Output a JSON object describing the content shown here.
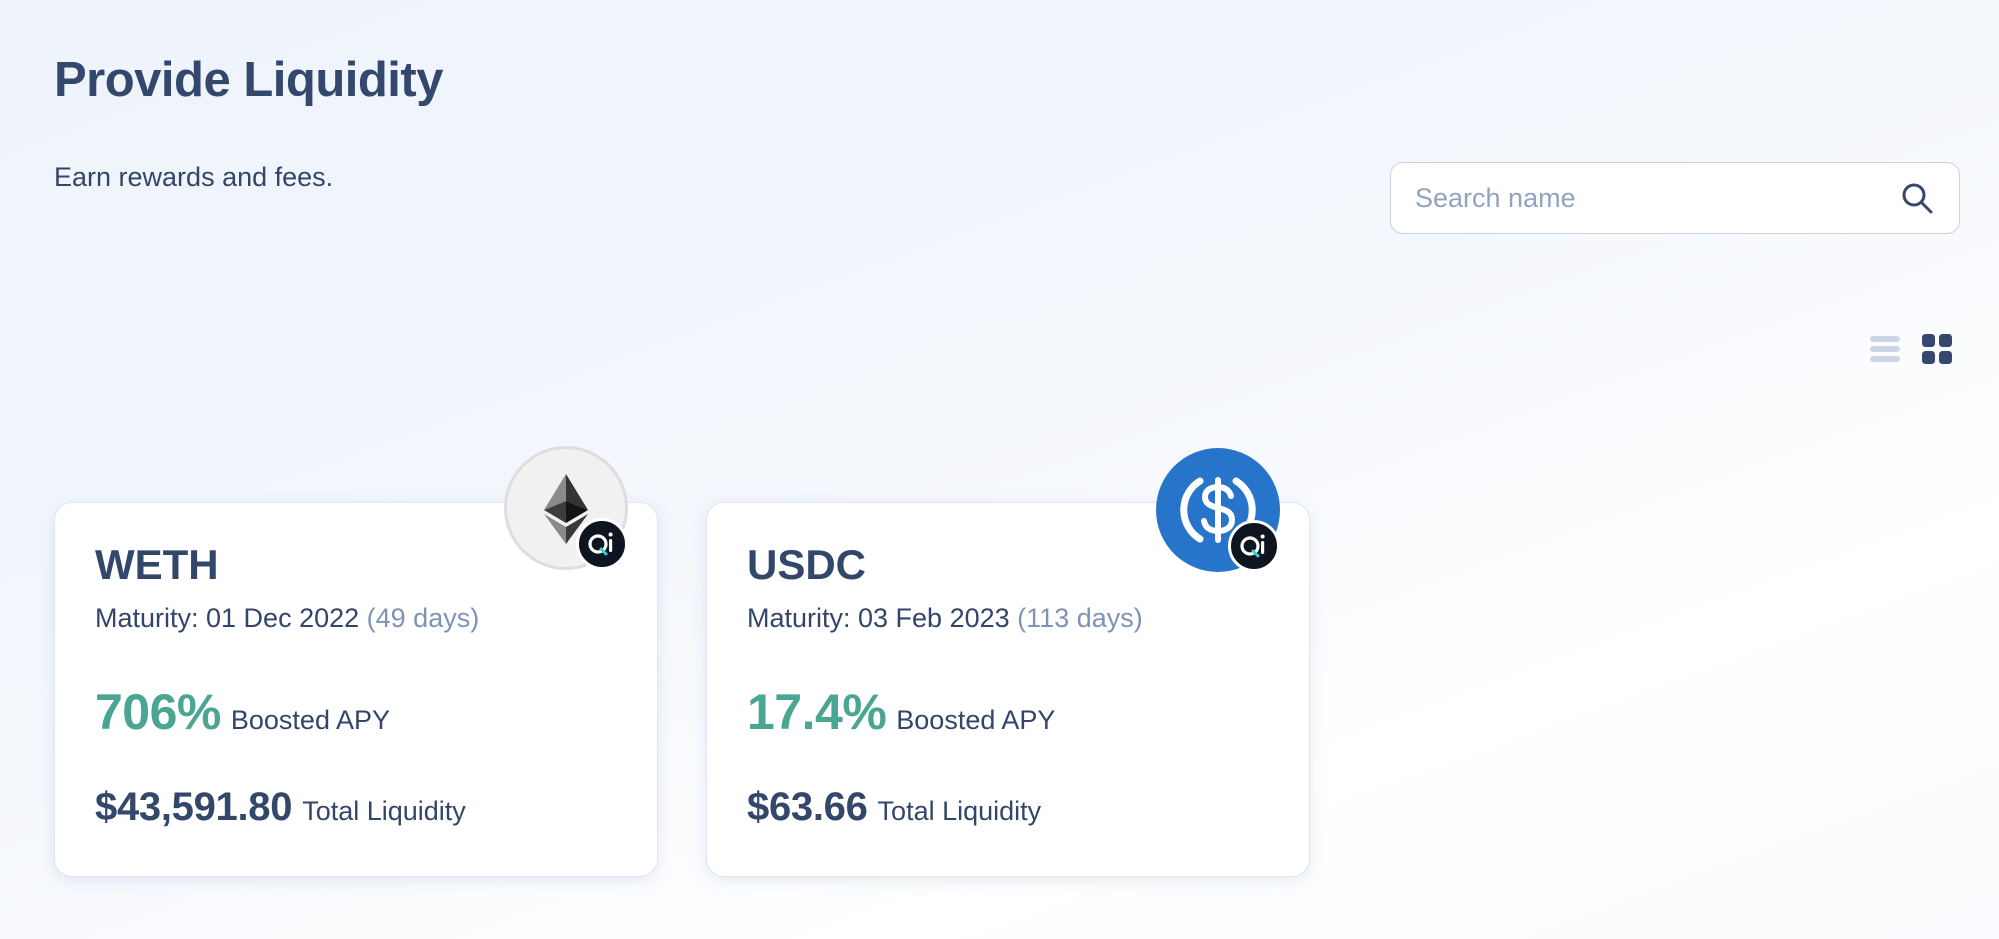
{
  "page": {
    "title": "Provide Liquidity",
    "subtitle": "Earn rewards and fees."
  },
  "search": {
    "placeholder": "Search name",
    "value": ""
  },
  "view": {
    "active": "grid"
  },
  "colors": {
    "title": "#34486d",
    "apy": "#4aa592",
    "days": "#7f93b6",
    "usdc_brand": "#2775ca"
  },
  "pools": [
    {
      "name": "WETH",
      "token_icon": "eth-icon",
      "badge_icon": "qi-icon",
      "maturity_label": "Maturity: 01 Dec 2022",
      "days": "(49 days)",
      "apy": "706%",
      "apy_label": "Boosted APY",
      "liquidity": "$43,591.80",
      "liquidity_label": "Total Liquidity"
    },
    {
      "name": "USDC",
      "token_icon": "usdc-icon",
      "badge_icon": "qi-icon",
      "maturity_label": "Maturity: 03 Feb 2023",
      "days": "(113 days)",
      "apy": "17.4%",
      "apy_label": "Boosted APY",
      "liquidity": "$63.66",
      "liquidity_label": "Total Liquidity"
    }
  ]
}
